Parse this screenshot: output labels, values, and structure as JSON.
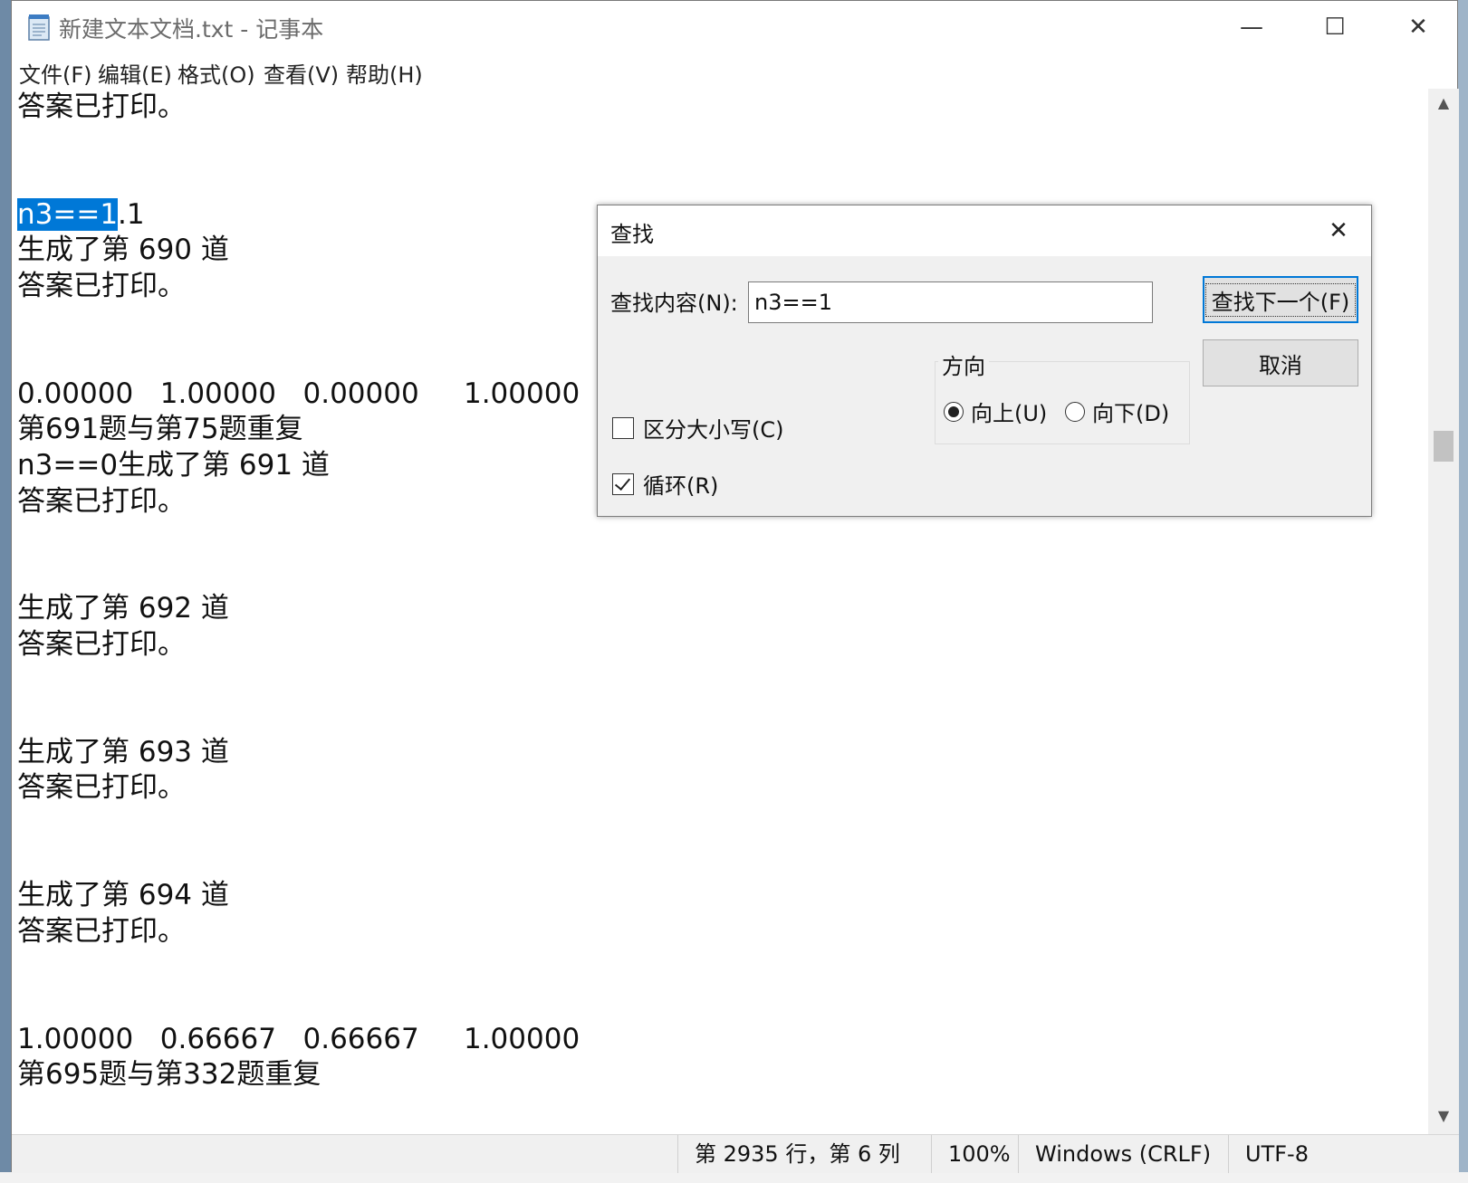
{
  "window": {
    "title": "新建文本文档.txt - 记事本",
    "controls": {
      "minimize": "—",
      "maximize": "☐",
      "close": "✕"
    }
  },
  "menu": [
    "文件(F)",
    "编辑(E)",
    "格式(O)",
    "查看(V)",
    "帮助(H)"
  ],
  "editor": {
    "selected_text": "n3==1",
    "lines": [
      {
        "text": "答案已打印。"
      },
      {
        "text": ""
      },
      {
        "text": ""
      },
      {
        "text": ".1",
        "selected_prefix": true
      },
      {
        "text": "生成了第 690 道"
      },
      {
        "text": "答案已打印。"
      },
      {
        "text": ""
      },
      {
        "text": ""
      },
      {
        "text": "0.00000   1.00000   0.00000     1.00000"
      },
      {
        "text": "第691题与第75题重复"
      },
      {
        "text": "n3==0生成了第 691 道"
      },
      {
        "text": "答案已打印。"
      },
      {
        "text": ""
      },
      {
        "text": ""
      },
      {
        "text": "生成了第 692 道"
      },
      {
        "text": "答案已打印。"
      },
      {
        "text": ""
      },
      {
        "text": ""
      },
      {
        "text": "生成了第 693 道"
      },
      {
        "text": "答案已打印。"
      },
      {
        "text": ""
      },
      {
        "text": ""
      },
      {
        "text": "生成了第 694 道"
      },
      {
        "text": "答案已打印。"
      },
      {
        "text": ""
      },
      {
        "text": ""
      },
      {
        "text": "1.00000   0.66667   0.66667     1.00000"
      },
      {
        "text": "第695题与第332题重复"
      }
    ]
  },
  "status": {
    "position": "第 2935 行，第 6 列",
    "zoom": "100%",
    "line_ending": "Windows (CRLF)",
    "encoding": "UTF-8"
  },
  "find_dialog": {
    "title": "查找",
    "find_label": "查找内容(N):",
    "find_value": "n3==1",
    "find_next": "查找下一个(F)",
    "cancel": "取消",
    "direction_label": "方向",
    "up": "向上(U)",
    "down": "向下(D)",
    "direction_selected": "up",
    "match_case": "区分大小写(C)",
    "match_case_checked": false,
    "wrap": "循环(R)",
    "wrap_checked": true
  },
  "colors": {
    "selection": "#0078d7",
    "focus_border": "#0078d7"
  }
}
